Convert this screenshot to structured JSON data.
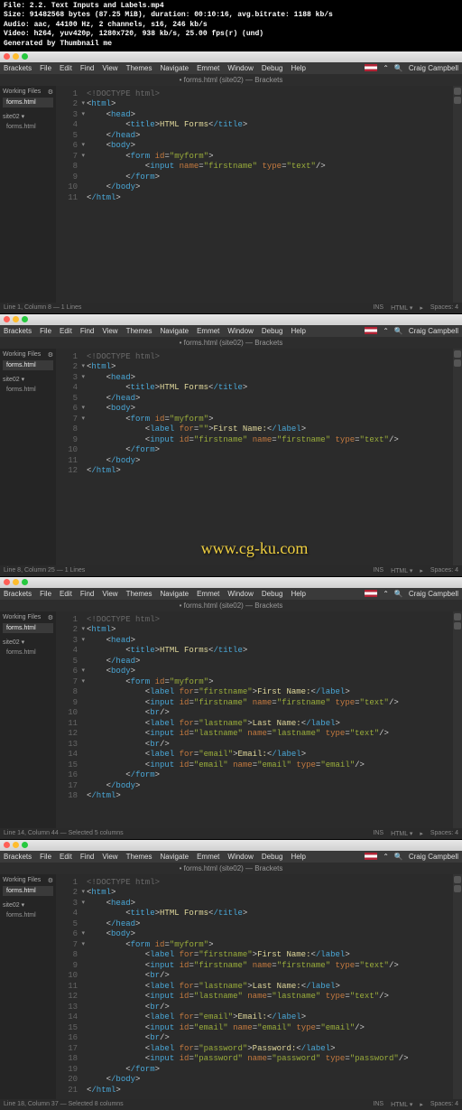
{
  "file_info": {
    "file": "File: 2.2. Text Inputs and Labels.mp4",
    "size": "Size: 91482568 bytes (87.25 MiB), duration: 00:10:16, avg.bitrate: 1188 kb/s",
    "audio": "Audio: aac, 44100 Hz, 2 channels, s16, 246 kb/s",
    "video": "Video: h264, yuv420p, 1280x720, 938 kb/s, 25.00 fps(r) (und)",
    "generated": "Generated by Thumbnail me"
  },
  "menu": {
    "items": [
      "Brackets",
      "File",
      "Edit",
      "Find",
      "View",
      "Themes",
      "Navigate",
      "Emmet",
      "Window",
      "Debug",
      "Help"
    ],
    "user": "Craig Campbell"
  },
  "tabbar": "• forms.html (site02) — Brackets",
  "sidebar": {
    "working_files_head": "Working Files",
    "working_file": "forms.html",
    "project": "site02 ▾",
    "project_file": "forms.html"
  },
  "status": {
    "left_p1": "Line 1, Column 8 — 1 Lines",
    "left_p2": "Line 8, Column 25 — 1 Lines",
    "left_p3": "Line 14, Column 44 — Selected 5 columns",
    "left_p4": "Line 18, Column 37 — Selected 8 columns",
    "right_items": [
      "INS",
      "HTML ▾",
      "▸",
      "Spaces: 4"
    ]
  },
  "watermark": "www.cg-ku.com",
  "code_common": {
    "doctype": "<!DOCTYPE html>",
    "html_open": "html",
    "head_open": "head",
    "title_open": "title",
    "title_text": "HTML Forms",
    "title_close": "/title",
    "head_close": "/head",
    "body_open": "body",
    "form": "form",
    "id_attr": "id",
    "myform": "\"myform\"",
    "input": "input",
    "label": "label",
    "for_attr": "for",
    "name_attr": "name",
    "type_attr": "type",
    "br": "br",
    "form_close": "/form",
    "body_close": "/body",
    "html_close": "/html",
    "label_close": "/label",
    "firstname": "\"firstname\"",
    "lastname": "\"lastname\"",
    "email": "\"email\"",
    "password": "\"password\"",
    "text_type": "\"text\"",
    "email_type": "\"email\"",
    "password_type": "\"password\"",
    "blank_q": "\"\"",
    "first_name_label": "First Name:",
    "last_name_label": "Last Name:",
    "email_label": "Email:",
    "password_label": "Password:"
  },
  "panes": {
    "p1_lines": 11,
    "p2_lines": 12,
    "p3_lines": 18,
    "p4_lines": 21
  }
}
